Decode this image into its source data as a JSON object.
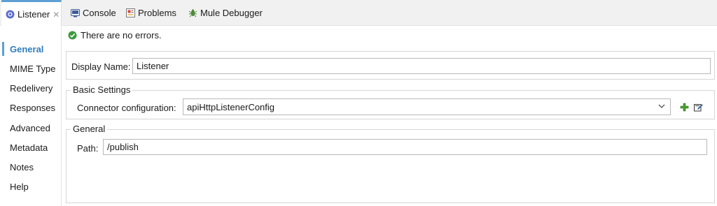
{
  "tabs": [
    {
      "label": "Listener",
      "icon": "listener-icon",
      "active": true,
      "closable": true
    },
    {
      "label": "Console",
      "icon": "console-icon"
    },
    {
      "label": "Problems",
      "icon": "problems-icon"
    },
    {
      "label": "Mule Debugger",
      "icon": "debugger-icon"
    }
  ],
  "tab_close_glyph": "✕",
  "nav": {
    "items": [
      "General",
      "MIME Type",
      "Redelivery",
      "Responses",
      "Advanced",
      "Metadata",
      "Notes",
      "Help"
    ],
    "active": "General"
  },
  "status": {
    "text": "There are no errors.",
    "icon": "check-icon"
  },
  "display": {
    "label": "Display Name:",
    "value": "Listener"
  },
  "basic": {
    "title": "Basic Settings",
    "connector_label": "Connector configuration:",
    "connector_value": "apiHttpListenerConfig",
    "add_icon": "add-icon",
    "edit_icon": "edit-icon"
  },
  "general": {
    "title": "General",
    "path_label": "Path:",
    "path_value": "/publish"
  },
  "colors": {
    "accent": "#5e9fd3",
    "active_nav": "#2f7dc1",
    "success": "#3c9a3c",
    "add": "#4a9e2f"
  }
}
